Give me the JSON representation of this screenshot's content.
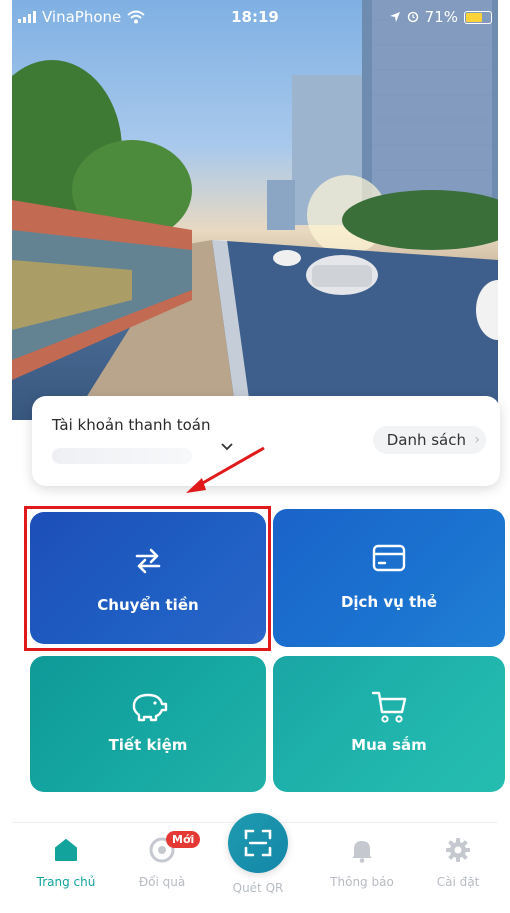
{
  "status_bar": {
    "carrier": "VinaPhone",
    "time": "18:19",
    "battery": "71%"
  },
  "account": {
    "label": "Tài khoản thanh toán",
    "list_button": "Danh sách"
  },
  "tiles": {
    "transfer": "Chuyển tiền",
    "card_service": "Dịch vụ thẻ",
    "savings": "Tiết kiệm",
    "shopping": "Mua sắm"
  },
  "nav": {
    "home": "Trang chủ",
    "gift": "Đổi quà",
    "gift_badge": "Mới",
    "qr": "Quét QR",
    "notifications": "Thông báo",
    "settings": "Cài đặt"
  },
  "colors": {
    "accent_teal": "#13a39d",
    "tile_blue": "#1d4fb8",
    "highlight_red": "#e0191a"
  },
  "icons": [
    "signal-icon",
    "wifi-icon",
    "location-icon",
    "battery-icon",
    "chevron-down-icon",
    "transfer-arrows-icon",
    "credit-card-icon",
    "piggy-bank-icon",
    "shopping-cart-icon",
    "home-icon",
    "gift-icon",
    "qr-scan-icon",
    "bell-icon",
    "gear-icon"
  ]
}
